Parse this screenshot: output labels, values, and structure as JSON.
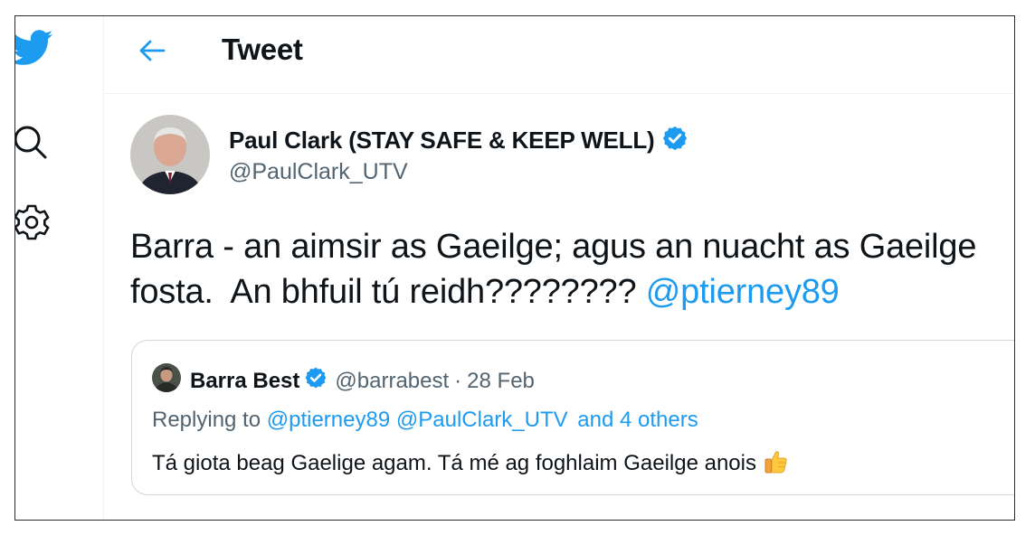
{
  "header": {
    "title": "Tweet"
  },
  "tweet": {
    "author_name": "Paul Clark (STAY SAFE & KEEP WELL)",
    "author_handle": "@PaulClark_UTV",
    "text_line1": "Barra - an aimsir as Gaeilge; agus an nuacht as Gaeilge",
    "text_line2": "fosta.  An bhfuil tú reidh????????",
    "mention": "@ptierney89",
    "verified": true
  },
  "quoted_tweet": {
    "author_name": "Barra Best",
    "author_handle": "@barrabest",
    "separator": "·",
    "date": "28 Feb",
    "replying_prefix": "Replying to",
    "replying_mention_1": "@ptierney89",
    "replying_mention_2": "@PaulClark_UTV",
    "replying_suffix": "and 4 others",
    "text": "Tá giota beag Gaelige agam. Tá mé ag foghlaim Gaeilge anois",
    "emoji": "thumbs-up",
    "verified": true
  },
  "icons": {
    "logo": "twitter-bird-icon",
    "search": "search-icon",
    "settings": "gear-icon",
    "back": "back-arrow-icon"
  },
  "colors": {
    "accent": "#1d9bf0",
    "text_primary": "#0f1419",
    "text_secondary": "#536471",
    "border": "#cfd9de"
  }
}
